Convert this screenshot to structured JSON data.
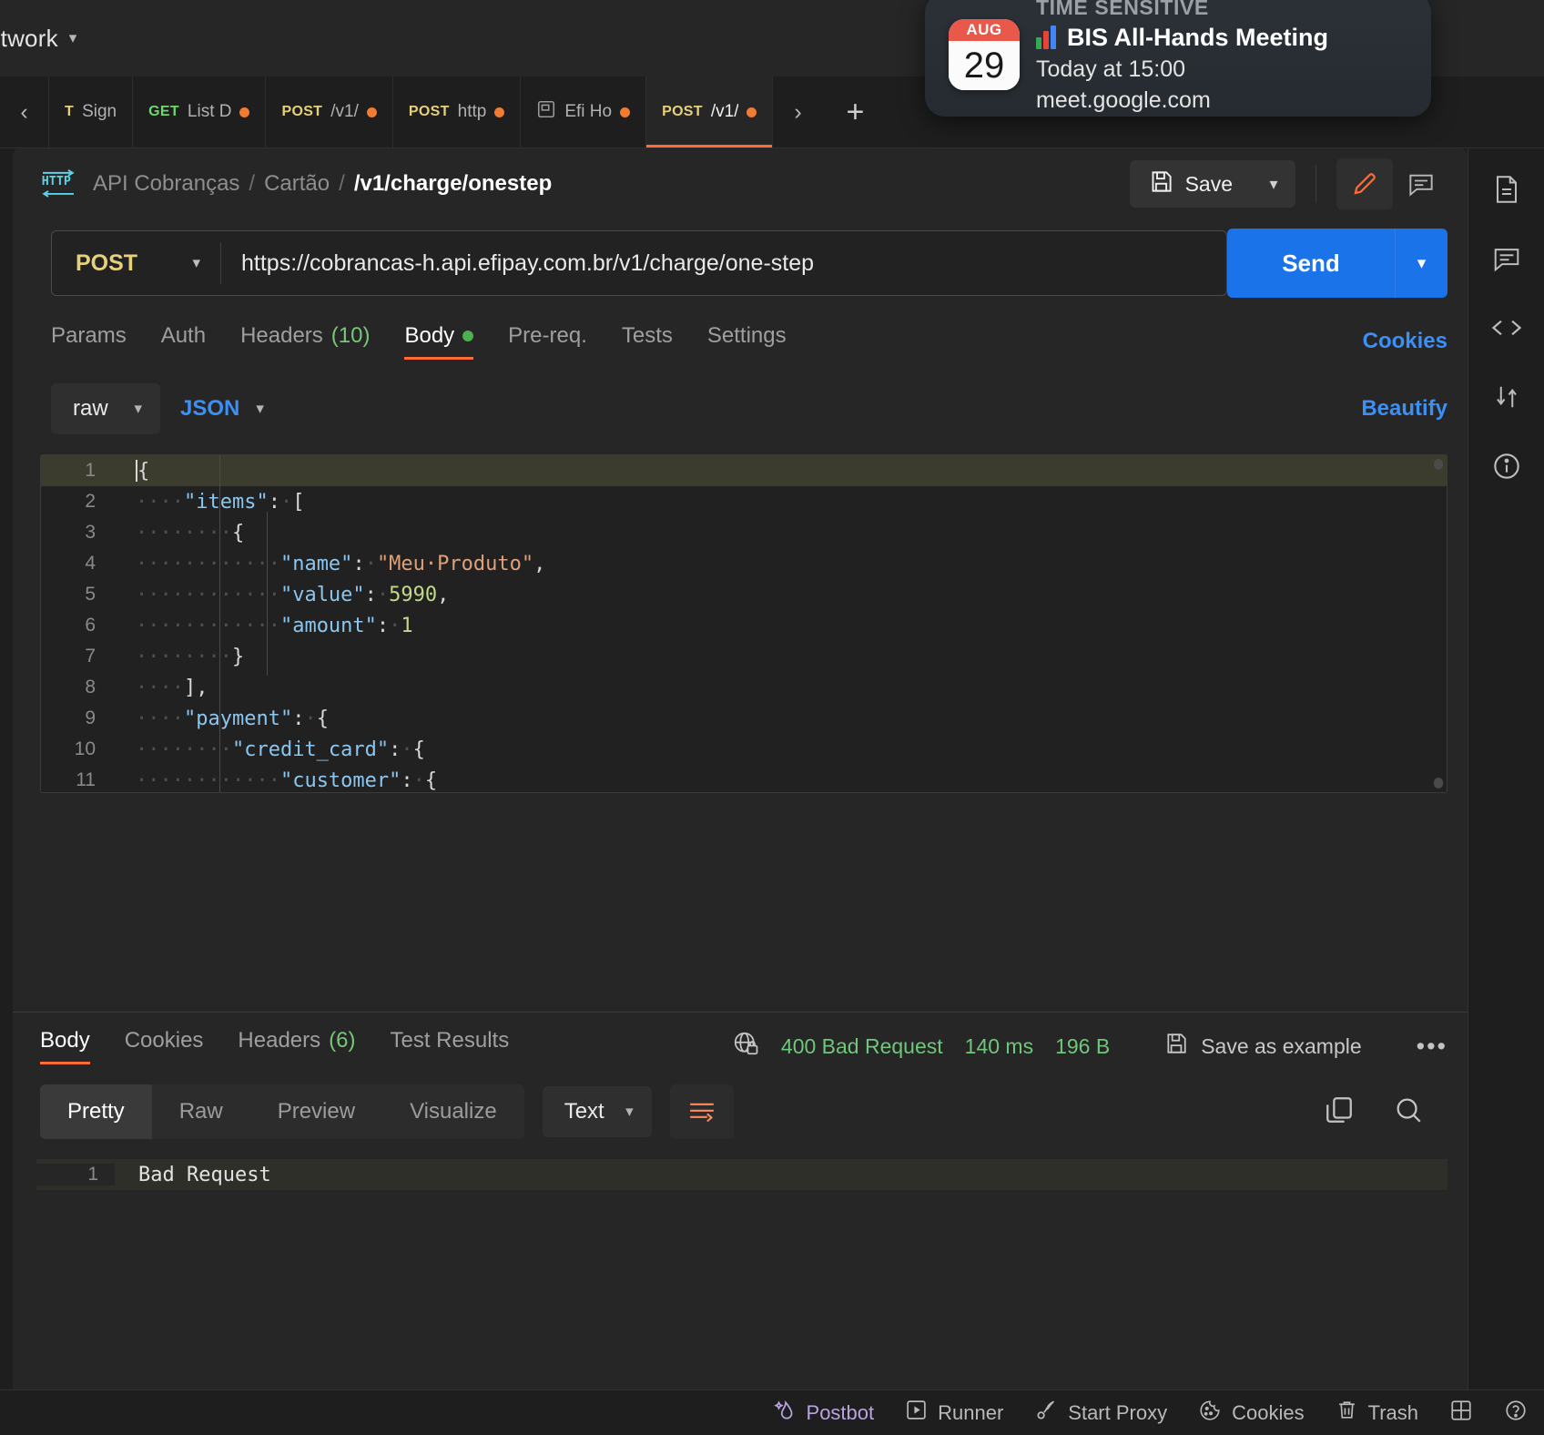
{
  "header": {
    "workspace_name": "etwork",
    "search_icon": "search-icon"
  },
  "tabstrip": {
    "prev_label": "‹",
    "next_label": "›",
    "plus_label": "+",
    "tabs": [
      {
        "verb": "T",
        "name": "Sign ",
        "verb_class": "post",
        "dirty": false,
        "active": false
      },
      {
        "verb": "GET",
        "name": "List D",
        "verb_class": "get",
        "dirty": true,
        "active": false
      },
      {
        "verb": "POST",
        "name": "/v1/",
        "verb_class": "post",
        "dirty": true,
        "active": false
      },
      {
        "verb": "POST",
        "name": "http",
        "verb_class": "post",
        "dirty": true,
        "active": false
      },
      {
        "verb": "",
        "name": "Efi Ho",
        "verb_class": "post",
        "dirty": true,
        "active": false
      },
      {
        "verb": "POST",
        "name": "/v1/",
        "verb_class": "post",
        "dirty": true,
        "active": true
      }
    ]
  },
  "breadcrumb": {
    "protocol_icon": "http-icon",
    "collection": "API Cobranças",
    "folder": "Cartão",
    "request": "/v1/charge/onestep",
    "separator": "/"
  },
  "toolbar": {
    "save_label": "Save",
    "save_icon": "floppy-icon",
    "save_caret": "⌵",
    "edit_icon": "pencil-icon",
    "comment_icon": "comment-icon"
  },
  "request": {
    "method": "POST",
    "method_caret": "⌵",
    "url": "https://cobrancas-h.api.efipay.com.br/v1/charge/one-step",
    "send_label": "Send",
    "send_caret": "⌵",
    "tabs": [
      {
        "label": "Params",
        "active": false,
        "count": "",
        "dot": false
      },
      {
        "label": "Auth",
        "active": false,
        "count": "",
        "dot": false
      },
      {
        "label": "Headers",
        "active": false,
        "count": "(10)",
        "dot": false
      },
      {
        "label": "Body",
        "active": true,
        "count": "",
        "dot": true
      },
      {
        "label": "Pre-req.",
        "active": false,
        "count": "",
        "dot": false
      },
      {
        "label": "Tests",
        "active": false,
        "count": "",
        "dot": false
      },
      {
        "label": "Settings",
        "active": false,
        "count": "",
        "dot": false
      }
    ],
    "cookies_link": "Cookies"
  },
  "body_toolbar": {
    "mode": "raw",
    "mode_caret": "⌵",
    "format": "JSON",
    "format_caret": "⌵",
    "beautify": "Beautify"
  },
  "body_editor": {
    "lines": [
      {
        "n": "1",
        "indent": "",
        "tokens": [
          {
            "t": "{",
            "c": "p"
          }
        ],
        "highlight": true,
        "cursor": true
      },
      {
        "n": "2",
        "indent": "····",
        "tokens": [
          {
            "t": "\"items\"",
            "c": "k"
          },
          {
            "t": ":",
            "c": "p"
          },
          {
            "t": "·",
            "c": "ind"
          },
          {
            "t": "[",
            "c": "p"
          }
        ],
        "highlight": false,
        "cursor": false
      },
      {
        "n": "3",
        "indent": "········",
        "tokens": [
          {
            "t": "{",
            "c": "p"
          }
        ],
        "highlight": false,
        "cursor": false
      },
      {
        "n": "4",
        "indent": "············",
        "tokens": [
          {
            "t": "\"name\"",
            "c": "k"
          },
          {
            "t": ":",
            "c": "p"
          },
          {
            "t": "·",
            "c": "ind"
          },
          {
            "t": "\"Meu·Produto\"",
            "c": "s"
          },
          {
            "t": ",",
            "c": "p"
          }
        ],
        "highlight": false,
        "cursor": false
      },
      {
        "n": "5",
        "indent": "············",
        "tokens": [
          {
            "t": "\"value\"",
            "c": "k"
          },
          {
            "t": ":",
            "c": "p"
          },
          {
            "t": "·",
            "c": "ind"
          },
          {
            "t": "5990",
            "c": "n"
          },
          {
            "t": ",",
            "c": "p"
          }
        ],
        "highlight": false,
        "cursor": false
      },
      {
        "n": "6",
        "indent": "············",
        "tokens": [
          {
            "t": "\"amount\"",
            "c": "k"
          },
          {
            "t": ":",
            "c": "p"
          },
          {
            "t": "·",
            "c": "ind"
          },
          {
            "t": "1",
            "c": "n"
          }
        ],
        "highlight": false,
        "cursor": false
      },
      {
        "n": "7",
        "indent": "········",
        "tokens": [
          {
            "t": "}",
            "c": "p"
          }
        ],
        "highlight": false,
        "cursor": false
      },
      {
        "n": "8",
        "indent": "····",
        "tokens": [
          {
            "t": "],",
            "c": "p"
          }
        ],
        "highlight": false,
        "cursor": false
      },
      {
        "n": "9",
        "indent": "····",
        "tokens": [
          {
            "t": "\"payment\"",
            "c": "k"
          },
          {
            "t": ":",
            "c": "p"
          },
          {
            "t": "·",
            "c": "ind"
          },
          {
            "t": "{",
            "c": "p"
          }
        ],
        "highlight": false,
        "cursor": false
      },
      {
        "n": "10",
        "indent": "········",
        "tokens": [
          {
            "t": "\"credit_card\"",
            "c": "k"
          },
          {
            "t": ":",
            "c": "p"
          },
          {
            "t": "·",
            "c": "ind"
          },
          {
            "t": "{",
            "c": "p"
          }
        ],
        "highlight": false,
        "cursor": false
      },
      {
        "n": "11",
        "indent": "············",
        "tokens": [
          {
            "t": "\"customer\"",
            "c": "k"
          },
          {
            "t": ":",
            "c": "p"
          },
          {
            "t": "·",
            "c": "ind"
          },
          {
            "t": "{",
            "c": "p"
          }
        ],
        "highlight": false,
        "cursor": false
      }
    ]
  },
  "response": {
    "tabs": [
      {
        "label": "Body",
        "active": true,
        "count": ""
      },
      {
        "label": "Cookies",
        "active": false,
        "count": ""
      },
      {
        "label": "Headers",
        "active": false,
        "count": "(6)"
      },
      {
        "label": "Test Results",
        "active": false,
        "count": ""
      }
    ],
    "secure_icon": "globe-lock-icon",
    "status": "400 Bad Request",
    "time": "140 ms",
    "size": "196 B",
    "save_example": "Save as example",
    "save_example_icon": "floppy-icon",
    "more_icon": "more-options-icon",
    "view_modes": [
      {
        "label": "Pretty",
        "active": true
      },
      {
        "label": "Raw",
        "active": false
      },
      {
        "label": "Preview",
        "active": false
      },
      {
        "label": "Visualize",
        "active": false
      }
    ],
    "format": "Text",
    "format_caret": "⌵",
    "wrap_icon": "word-wrap-icon",
    "copy_icon": "copy-icon",
    "search_icon": "search-icon",
    "body_lines": [
      {
        "n": "1",
        "text": "Bad Request"
      }
    ]
  },
  "right_rail": {
    "icons": [
      "documentation-icon",
      "comments-icon",
      "code-snippet-icon",
      "related-requests-icon",
      "info-icon"
    ]
  },
  "footer": {
    "items": [
      {
        "label": "Postbot",
        "icon": "postbot-icon",
        "accent": true
      },
      {
        "label": "Runner",
        "icon": "runner-icon",
        "accent": false
      },
      {
        "label": "Start Proxy",
        "icon": "proxy-icon",
        "accent": false
      },
      {
        "label": "Cookies",
        "icon": "cookie-icon",
        "accent": false
      },
      {
        "label": "Trash",
        "icon": "trash-icon",
        "accent": false
      },
      {
        "label": "",
        "icon": "layout-icon",
        "accent": false
      },
      {
        "label": "",
        "icon": "help-icon",
        "accent": false
      }
    ]
  },
  "notification": {
    "badge": "TIME SENSITIVE",
    "app_icon": "calendar-icon",
    "month": "AUG",
    "day": "29",
    "event_icon": "meet-chart-icon",
    "title": "BIS All-Hands Meeting",
    "time": "Today at 15:00",
    "location": "meet.google.com"
  },
  "colors": {
    "accent": "#ff6c37",
    "send": "#1a73e8",
    "link": "#3b8ff5",
    "success": "#6fc77a",
    "method": "#e7d07a"
  }
}
